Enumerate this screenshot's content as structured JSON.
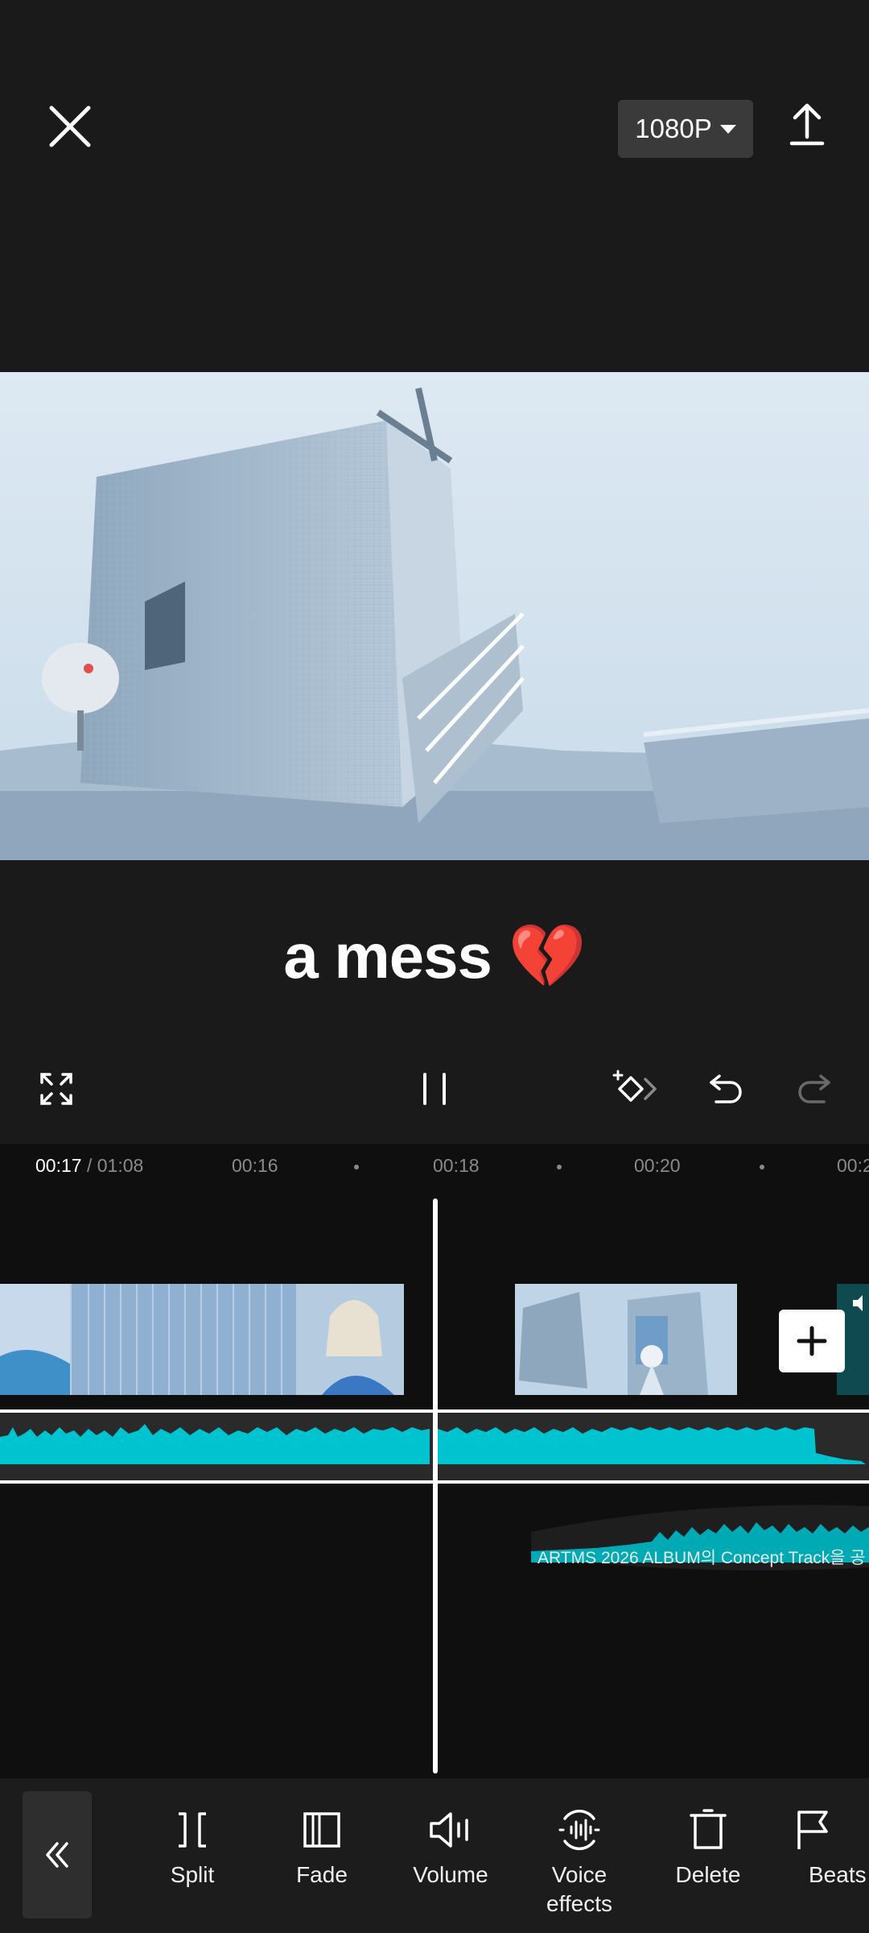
{
  "top_bar": {
    "close_icon": "close-icon",
    "resolution_label": "1080P",
    "export_icon": "export-icon"
  },
  "preview": {
    "caption": "a mess 💔"
  },
  "controls": {
    "fullscreen_icon": "fullscreen-icon",
    "pause_icon": "pause-icon",
    "keyframe_icon": "keyframe-icon",
    "undo_icon": "undo-icon",
    "redo_icon": "redo-icon"
  },
  "timeline": {
    "current_time": "00:17",
    "total_time": "/ 01:08",
    "ticks": [
      "00:16",
      "00:18",
      "00:20",
      "00:2"
    ],
    "music_track_label": "ARTMS 2026 ALBUM의 Concept Track을 공"
  },
  "toolbar": {
    "items": [
      {
        "label": "Split",
        "icon": "split-icon"
      },
      {
        "label": "Fade",
        "icon": "fade-icon"
      },
      {
        "label": "Volume",
        "icon": "volume-icon"
      },
      {
        "label": "Voice\neffects",
        "icon": "voice-effects-icon"
      },
      {
        "label": "Delete",
        "icon": "delete-icon"
      },
      {
        "label": "Beats",
        "icon": "beats-icon"
      }
    ]
  },
  "colors": {
    "accent_waveform": "#00c3d0",
    "background": "#1a1a1a"
  }
}
